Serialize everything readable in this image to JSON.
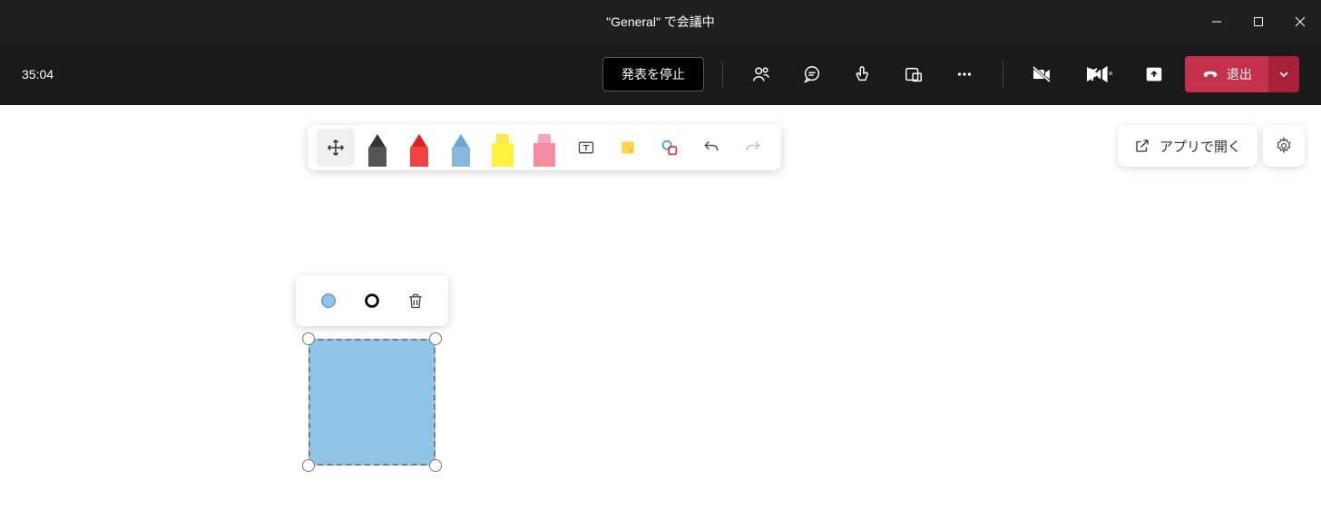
{
  "window": {
    "title": "\"General\" で会議中"
  },
  "meeting": {
    "timer": "35:04",
    "stop_present": "発表を停止",
    "leave": "退出"
  },
  "whiteboard": {
    "open_in_app": "アプリで開く"
  },
  "icons": {
    "move": "move",
    "pen_black": "pen-black",
    "pen_red": "pen-red",
    "pen_blue": "pen-blue",
    "highlighter_yellow": "highlighter-yellow",
    "highlighter_pink": "highlighter-pink",
    "textbox": "textbox",
    "note": "note",
    "shapes": "shapes",
    "undo": "undo",
    "redo": "redo"
  },
  "shape_tools": {
    "fill_color": "#8fc6e8",
    "outline_color": "#000000"
  }
}
